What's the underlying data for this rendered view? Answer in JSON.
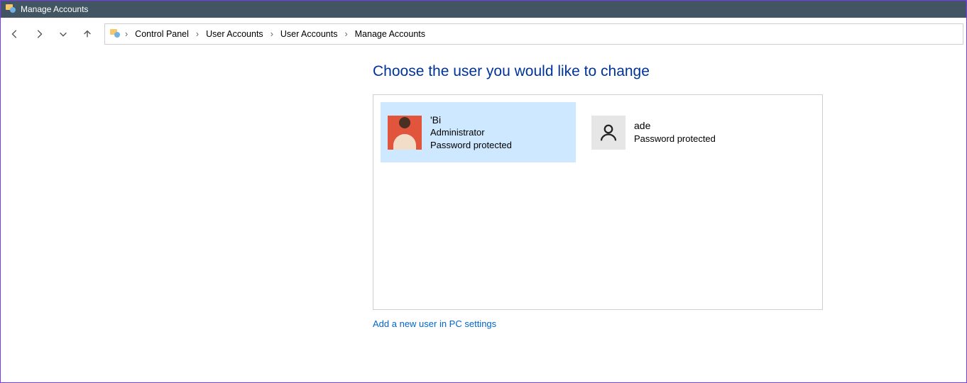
{
  "window": {
    "title": "Manage Accounts"
  },
  "breadcrumbs": {
    "items": [
      {
        "label": "Control Panel"
      },
      {
        "label": "User Accounts"
      },
      {
        "label": "User Accounts"
      },
      {
        "label": "Manage Accounts"
      }
    ]
  },
  "page": {
    "title": "Choose the user you would like to change",
    "add_user_link": "Add a new user in PC settings"
  },
  "accounts": [
    {
      "name": "'Bi",
      "role": "Administrator",
      "status": "Password protected",
      "selected": true,
      "avatar": "photo"
    },
    {
      "name": "ade",
      "role": "",
      "status": "Password protected",
      "selected": false,
      "avatar": "generic"
    }
  ]
}
